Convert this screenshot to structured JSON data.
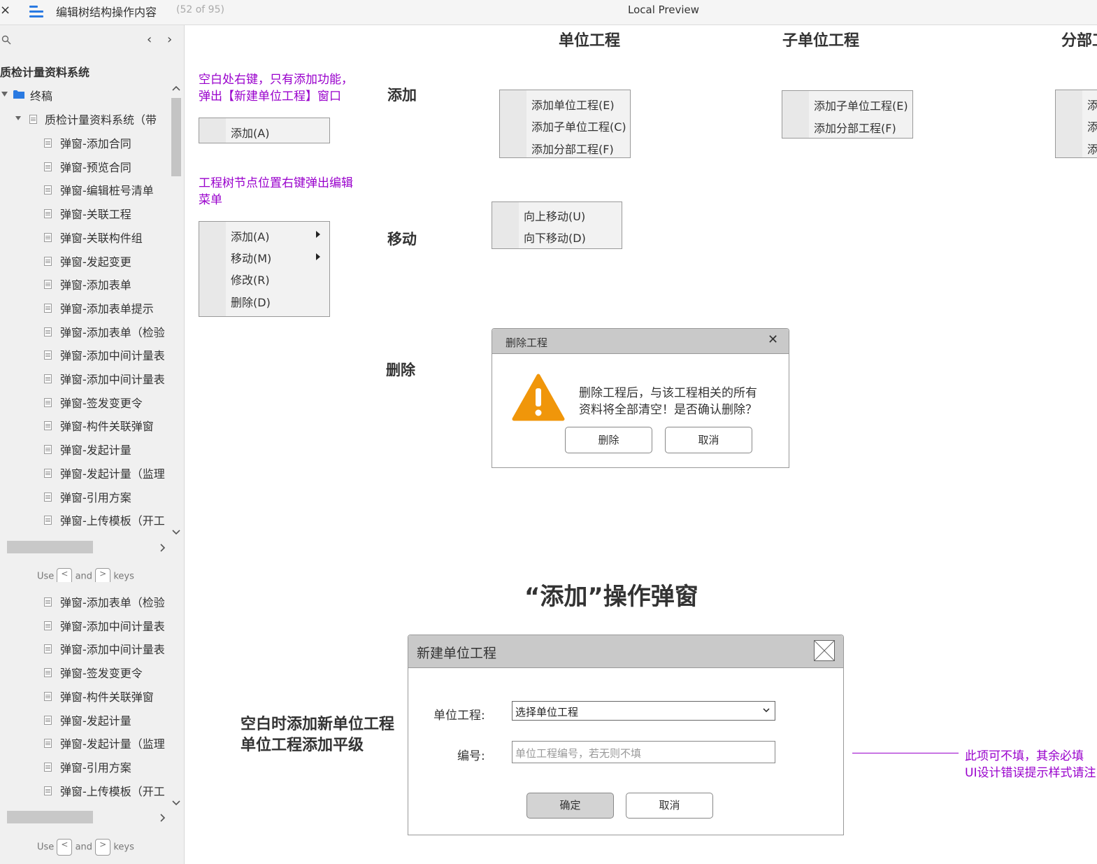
{
  "topbar": {
    "close": "×",
    "page_name": "编辑树结构操作内容",
    "page_count": "(52 of 95)",
    "preview_title": "Local Preview"
  },
  "sidebar": {
    "nav_prev": "‹",
    "nav_next": "›",
    "title": "质检计量资料系统",
    "folder": "终稿",
    "parent": "质检计量资料系统（带",
    "pages_top": [
      "弹窗-添加合同",
      "弹窗-预览合同",
      "弹窗-编辑桩号清单",
      "弹窗-关联工程",
      "弹窗-关联构件组",
      "弹窗-发起变更",
      "弹窗-添加表单",
      "弹窗-添加表单提示",
      "弹窗-添加表单（检验",
      "弹窗-添加中间计量表",
      "弹窗-添加中间计量表",
      "弹窗-签发变更令",
      "弹窗-构件关联弹窗",
      "弹窗-发起计量",
      "弹窗-发起计量（监理",
      "弹窗-引用方案",
      "弹窗-上传模板（开工"
    ],
    "pages_bottom": [
      "弹窗-添加表单（检验",
      "弹窗-添加中间计量表",
      "弹窗-添加中间计量表",
      "弹窗-签发变更令",
      "弹窗-构件关联弹窗",
      "弹窗-发起计量",
      "弹窗-发起计量（监理",
      "弹窗-引用方案",
      "弹窗-上传模板（开工"
    ],
    "hint": {
      "use": "Use",
      "and": "and",
      "keys": "keys",
      "key_prev": "<",
      "key_next": ">"
    }
  },
  "canvas": {
    "col_unit": "单位工程",
    "col_subunit": "子单位工程",
    "col_part": "分部工",
    "row_add": "添加",
    "row_move": "移动",
    "row_delete": "删除",
    "note_blank": "空白处右键，只有添加功能，弹出【新建单位工程】窗口",
    "note_blank_l1": "空白处右键，只有添加功能，",
    "note_blank_l2": "弹出【新建单位工程】窗口",
    "note_tree_l1": "工程树节点位置右键弹出编辑",
    "note_tree_l2": "菜单",
    "blank_menu": [
      "添加(A)"
    ],
    "node_menu": [
      "添加(A)",
      "移动(M)",
      "修改(R)",
      "删除(D)"
    ],
    "unit_add_menu": [
      "添加单位工程(E)",
      "添加子单位工程(C)",
      "添加分部工程(F)"
    ],
    "subunit_add_menu": [
      "添加子单位工程(E)",
      "添加分部工程(F)"
    ],
    "part_add_menu": [
      "添",
      "添",
      "添"
    ],
    "move_menu": [
      "向上移动(U)",
      "向下移动(D)"
    ],
    "delete_dialog": {
      "title": "删除工程",
      "close": "✕",
      "message_l1": "删除工程后，与该工程相关的所有",
      "message_l2": "资料将全部清空！是否确认删除？",
      "confirm": "删除",
      "cancel": "取消"
    },
    "section_title": "“添加”操作弹窗",
    "side_note_l1": "空白时添加新单位工程",
    "side_note_l2": "单位工程添加平级",
    "new_dialog": {
      "title": "新建单位工程",
      "unit_label": "单位工程:",
      "unit_value": "选择单位工程",
      "code_label": "编号:",
      "code_placeholder": "单位工程编号，若无则不填",
      "ok": "确定",
      "cancel": "取消"
    },
    "right_note_l1": "此项可不填，其余必填",
    "right_note_l2": "UI设计错误提示样式请注"
  },
  "colors": {
    "accent_blue": "#2a7ae2",
    "note_purple": "#9900cc",
    "warning_orange": "#f0960a"
  }
}
